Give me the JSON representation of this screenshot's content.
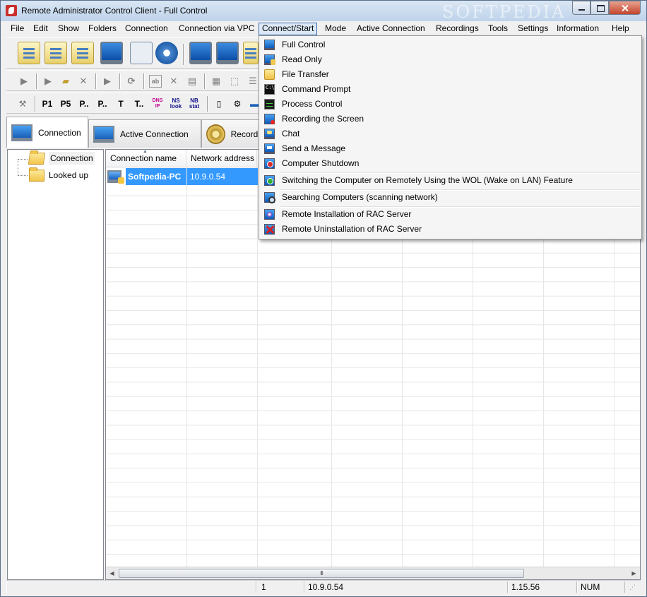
{
  "window": {
    "title": "Remote Administrator Control Client - Full Control",
    "watermark": "SOFTPEDIA"
  },
  "menubar": {
    "items": [
      "File",
      "Edit",
      "Show",
      "Folders",
      "Connection",
      "Connection via VPC",
      "Connect/Start",
      "Mode",
      "Active Connection",
      "Recordings",
      "Tools",
      "Settings",
      "Information",
      "Help"
    ],
    "open_item": "Connect/Start"
  },
  "toolbar3": {
    "labels": [
      "P1",
      "P5",
      "P..",
      "P..",
      "T",
      "T..",
      "DNS IP",
      "NS look",
      "NB stat"
    ]
  },
  "tabs": [
    {
      "label": "Connection",
      "active": true
    },
    {
      "label": "Active Connection",
      "active": false
    },
    {
      "label": "Recordi",
      "active": false
    }
  ],
  "tree": {
    "items": [
      {
        "label": "Connection",
        "selected": true
      },
      {
        "label": "Looked up",
        "selected": false
      }
    ]
  },
  "listview": {
    "columns": [
      "Connection name",
      "Network address"
    ],
    "rows": [
      {
        "name": "Softpedia-PC",
        "address": "10.9.0.54",
        "selected": true
      }
    ],
    "scroll_grip": "III"
  },
  "dropdown": {
    "items": [
      {
        "label": "Full Control",
        "icon": "monitor-icon"
      },
      {
        "label": "Read Only",
        "icon": "monitor-hand-icon"
      },
      {
        "label": "File Transfer",
        "icon": "folders-icon"
      },
      {
        "label": "Command Prompt",
        "icon": "command-prompt-icon"
      },
      {
        "label": "Process Control",
        "icon": "process-monitor-icon"
      },
      {
        "label": "Recording the Screen",
        "icon": "recording-icon"
      },
      {
        "label": "Chat",
        "icon": "chat-icon"
      },
      {
        "label": "Send a Message",
        "icon": "message-icon"
      },
      {
        "label": "Computer Shutdown",
        "icon": "shutdown-icon"
      },
      {
        "label": "Switching the Computer on Remotely Using the WOL (Wake on LAN) Feature",
        "icon": "wake-on-lan-icon"
      },
      {
        "label": "Searching Computers (scanning network)",
        "icon": "scan-network-icon"
      },
      {
        "label": "Remote Installation of RAC Server",
        "icon": "install-icon"
      },
      {
        "label": "Remote Uninstallation of RAC Server",
        "icon": "uninstall-icon"
      }
    ]
  },
  "statusbar": {
    "count": "1",
    "address": "10.9.0.54",
    "version": "1.15.56",
    "numlock": "NUM"
  },
  "colors": {
    "selection": "#3399ff",
    "menu_highlight": "#dce8f6"
  }
}
